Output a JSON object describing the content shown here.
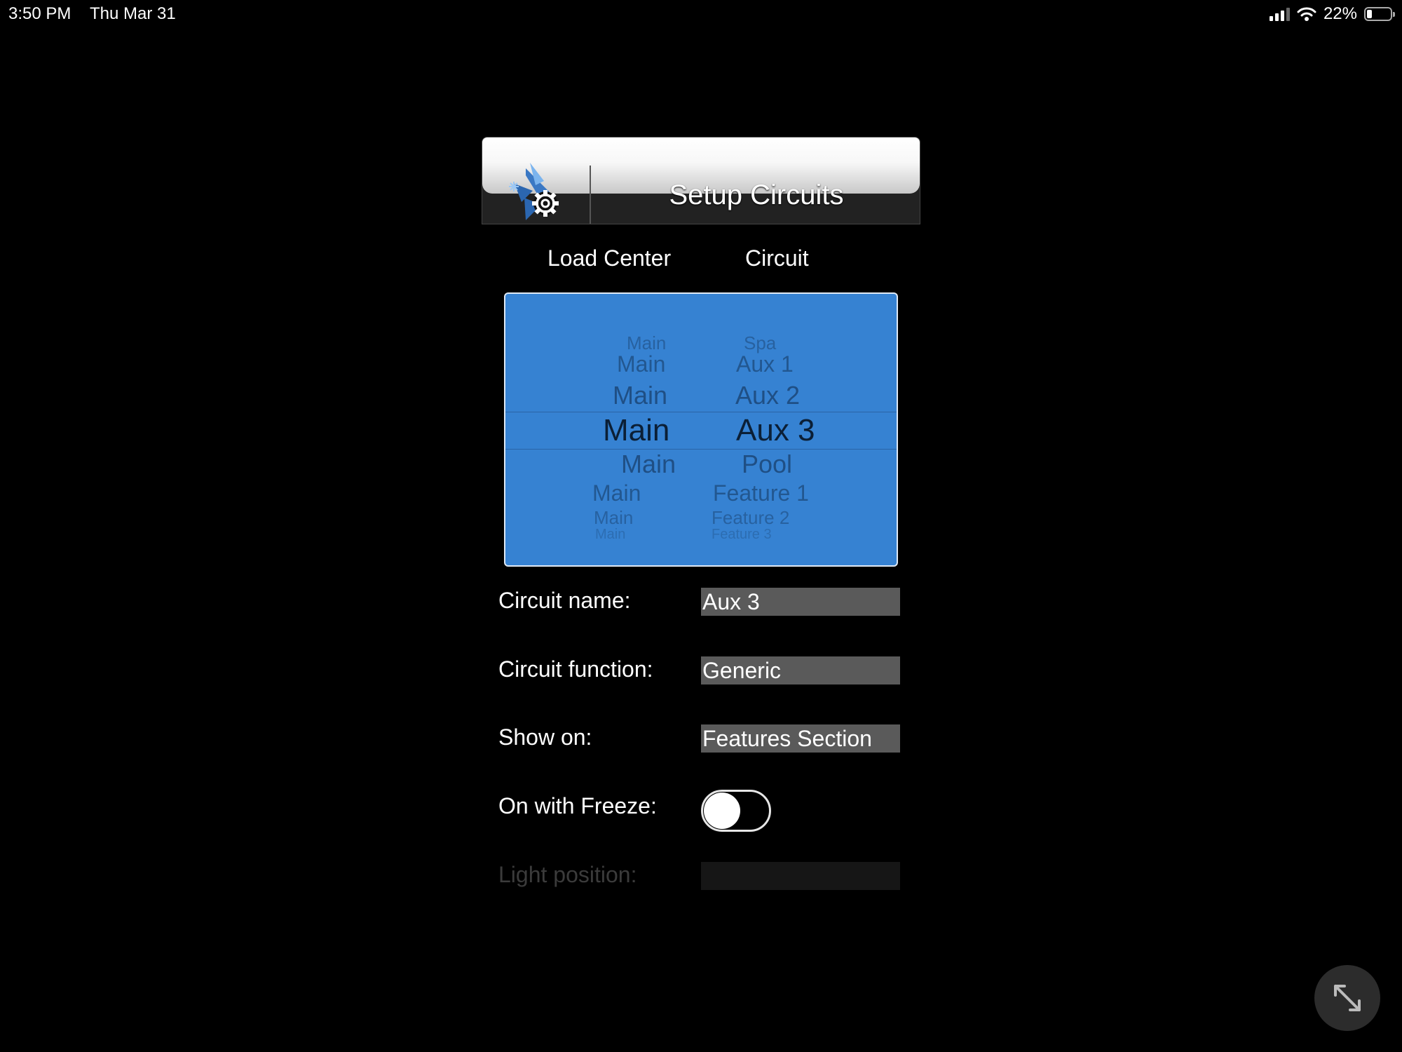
{
  "status_bar": {
    "time": "3:50 PM",
    "date": "Thu Mar 31",
    "battery_percent": "22%",
    "battery_level": 0.22,
    "icons": [
      "cellular-signal-icon",
      "wifi-icon",
      "battery-icon"
    ]
  },
  "header": {
    "title": "Setup Circuits",
    "icon": "circuit-gear-icon"
  },
  "picker": {
    "column_labels": {
      "load_center": "Load Center",
      "circuit": "Circuit"
    },
    "load_center_items": [
      "Main",
      "Main",
      "Main",
      "Main",
      "Main",
      "Main",
      "Main",
      "Main"
    ],
    "circuit_items": [
      "Spa",
      "Aux 1",
      "Aux 2",
      "Aux 3",
      "Pool",
      "Feature 1",
      "Feature 2",
      "Feature 3"
    ],
    "selected_index": 3,
    "selected_load_center": "Main",
    "selected_circuit": "Aux 3",
    "background_color": "#3682d2"
  },
  "form": {
    "circuit_name": {
      "label": "Circuit name:",
      "value": "Aux 3"
    },
    "circuit_function": {
      "label": "Circuit function:",
      "value": "Generic"
    },
    "show_on": {
      "label": "Show on:",
      "value": "Features Section"
    },
    "on_with_freeze": {
      "label": "On with Freeze:",
      "value": false
    },
    "light_position": {
      "label": "Light position:",
      "value": "",
      "enabled": false
    }
  },
  "expand_button": {
    "icon": "expand-arrows-icon"
  }
}
